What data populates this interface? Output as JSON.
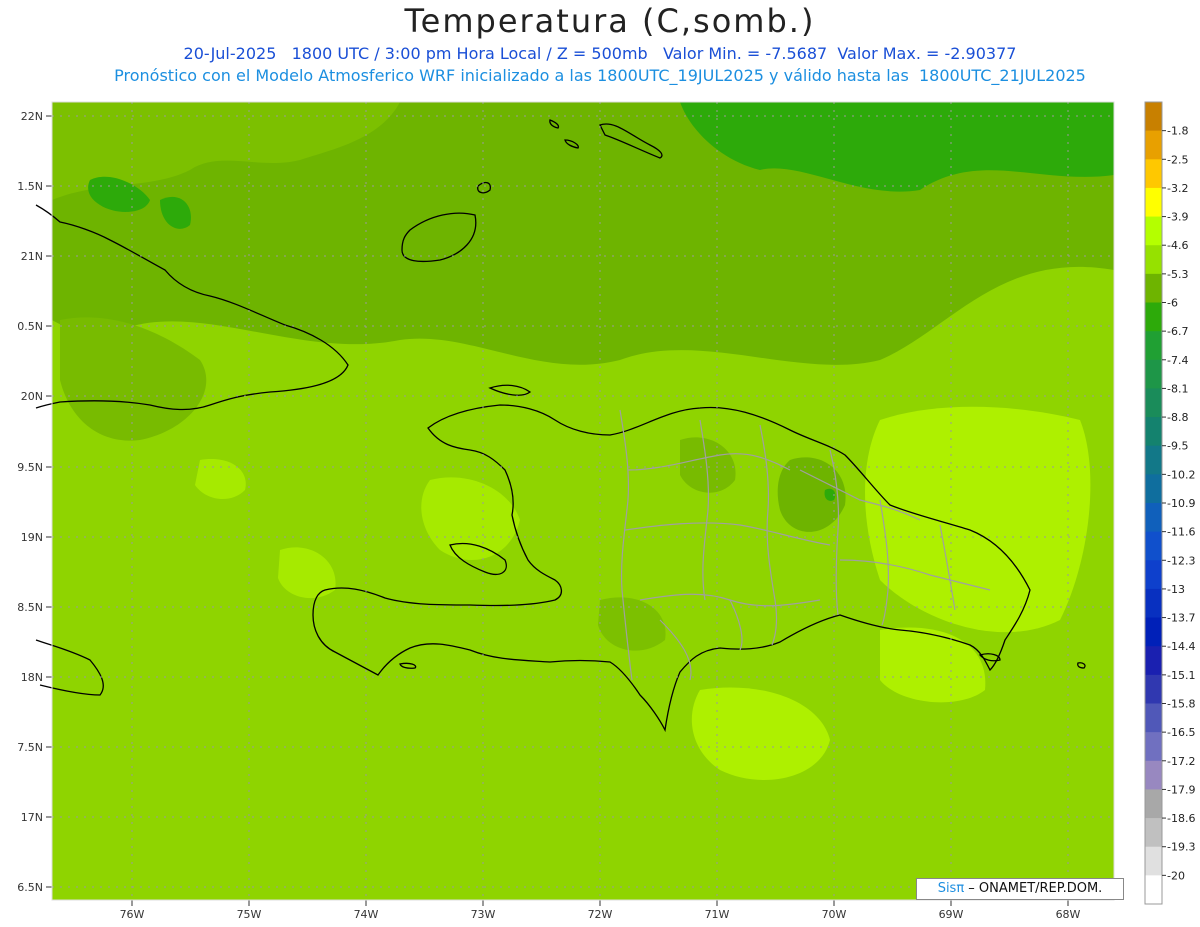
{
  "header": {
    "title": "Temperatura (C,somb.)",
    "line1": "20-Jul-2025   1800 UTC / 3:00 pm Hora Local / Z = 500mb   Valor Min. = -7.5687  Valor Max. = -2.90377",
    "line2": "Pronóstico con el Modelo Atmosferico WRF inicializado a las 1800UTC_19JUL2025 y válido hasta las  1800UTC_21JUL2025"
  },
  "map": {
    "lat_labels": [
      "22N",
      "1.5N",
      "21N",
      "0.5N",
      "20N",
      "9.5N",
      "19N",
      "8.5N",
      "18N",
      "7.5N",
      "17N",
      "6.5N"
    ],
    "lon_labels": [
      "76W",
      "75W",
      "74W",
      "73W",
      "72W",
      "71W",
      "70W",
      "69W",
      "68W"
    ],
    "region": "Hispaniola / Caribbean"
  },
  "legend": {
    "levels": [
      "-1.8",
      "-2.5",
      "-3.2",
      "-3.9",
      "-4.6",
      "-5.3",
      "-6",
      "-6.7",
      "-7.4",
      "-8.1",
      "-8.8",
      "-9.5",
      "-10.2",
      "-10.9",
      "-11.6",
      "-12.3",
      "-13",
      "-13.7",
      "-14.4",
      "-15.1",
      "-15.8",
      "-16.5",
      "-17.2",
      "-17.9",
      "-18.6",
      "-19.3",
      "-20"
    ],
    "colors": [
      "#c88000",
      "#e8a000",
      "#ffc800",
      "#ffff00",
      "#b4ff00",
      "#96e100",
      "#6eb400",
      "#2daa0a",
      "#20a033",
      "#1e9648",
      "#1a8c5a",
      "#14826e",
      "#127888",
      "#0f6e9e",
      "#1060bb",
      "#1050cc",
      "#0e40cc",
      "#0830c0",
      "#0020b8",
      "#1a20b0",
      "#3038b0",
      "#5058b8",
      "#7070c0",
      "#9888c0",
      "#a8a8a8",
      "#c0c0c0",
      "#e0e0e0",
      "#ffffff"
    ]
  },
  "footer": {
    "credit_sis": "Sisπ",
    "credit_text": " – ONAMET/REP.DOM."
  }
}
